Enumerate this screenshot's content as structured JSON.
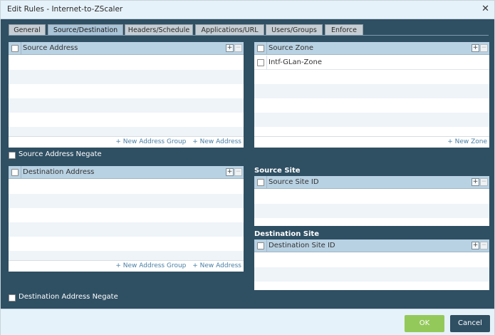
{
  "dialog": {
    "title": "Edit Rules - Internet-to-ZScaler",
    "close_glyph": "✕"
  },
  "tabs": [
    {
      "label": "General"
    },
    {
      "label": "Source/Destination"
    },
    {
      "label": "Headers/Schedule"
    },
    {
      "label": "Applications/URL"
    },
    {
      "label": "Users/Groups"
    },
    {
      "label": "Enforce"
    }
  ],
  "active_tab": "Source/Destination",
  "source_address": {
    "header": "Source Address",
    "plus": "+",
    "minus": "−",
    "link_group": "+ New Address Group",
    "link_address": "+ New Address"
  },
  "source_negate": {
    "label": "Source Address Negate"
  },
  "destination_address": {
    "header": "Destination Address",
    "plus": "+",
    "minus": "−",
    "link_group": "+ New Address Group",
    "link_address": "+ New Address"
  },
  "destination_negate": {
    "label": "Destination Address Negate"
  },
  "source_zone": {
    "header": "Source Zone",
    "plus": "+",
    "minus": "−",
    "items": [
      "Intf-GLan-Zone"
    ],
    "link_zone": "+ New Zone"
  },
  "source_site": {
    "section_title": "Source Site",
    "header": "Source Site ID",
    "plus": "+",
    "minus": "−"
  },
  "destination_site": {
    "section_title": "Destination Site",
    "header": "Destination Site ID",
    "plus": "+",
    "minus": "−"
  },
  "buttons": {
    "ok": "OK",
    "cancel": "Cancel"
  },
  "colors": {
    "dialog_bg": "#2f4f63",
    "header_bg": "#b9d2e3",
    "link": "#4a7fa4",
    "ok": "#93c95a",
    "cancel": "#2f4f63"
  }
}
